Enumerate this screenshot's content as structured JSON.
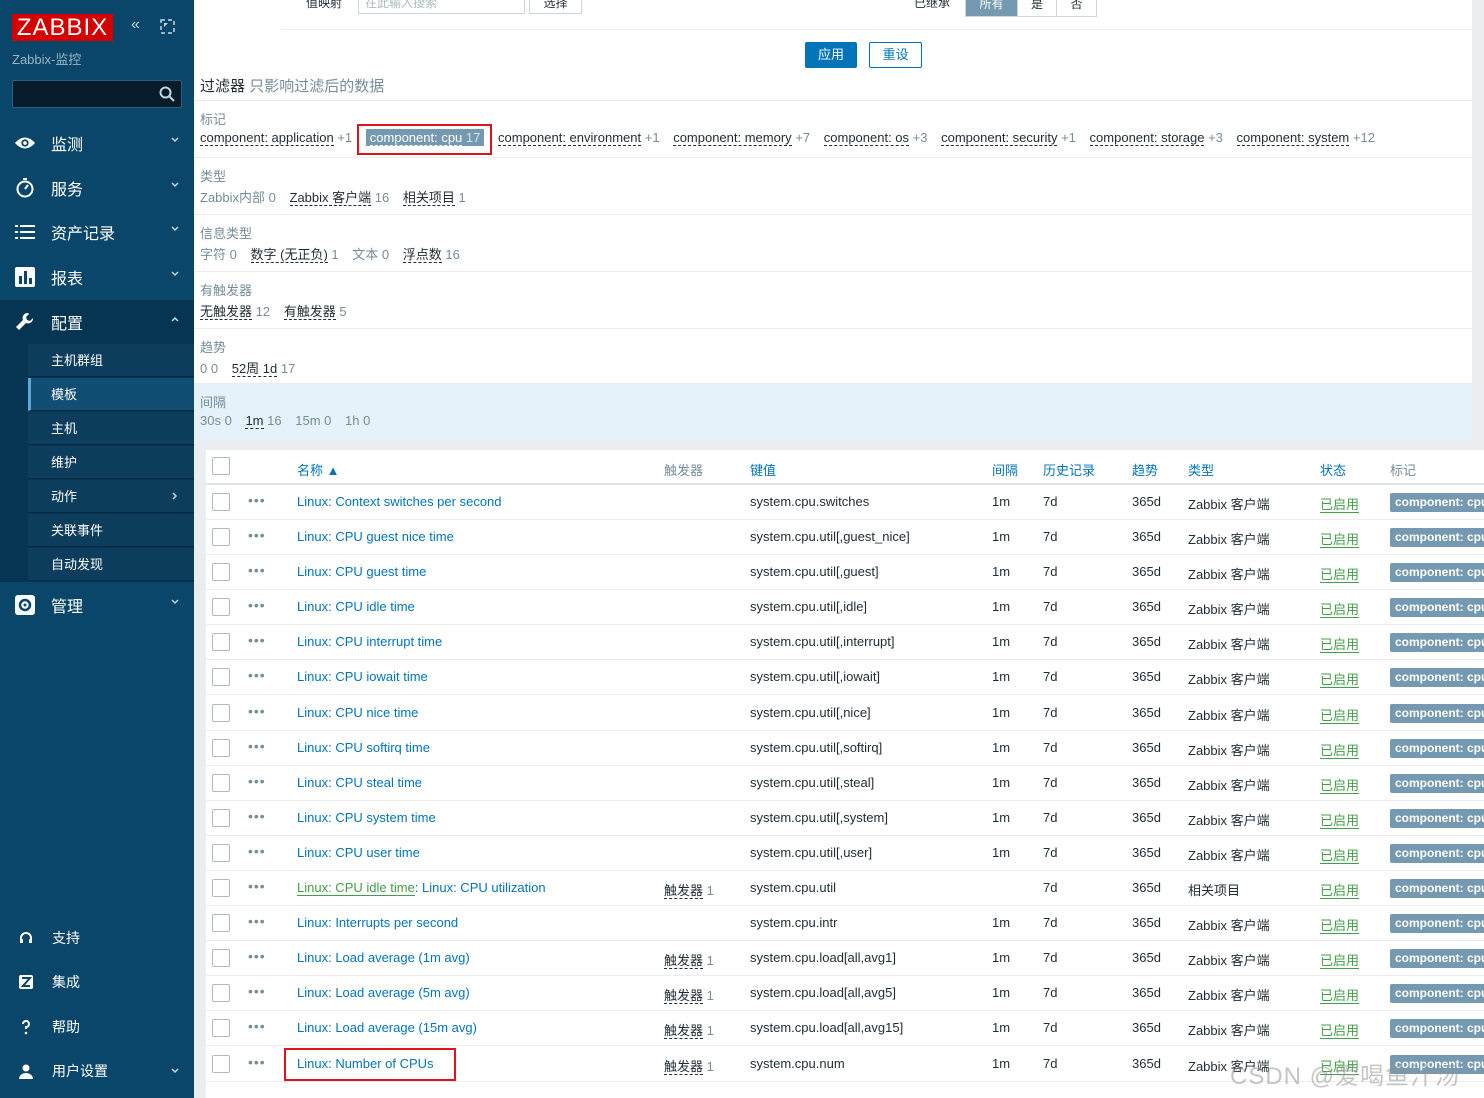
{
  "sidebar": {
    "logo": "ZABBIX",
    "collapse_glyph": "«",
    "server_name": "Zabbix-监控",
    "search_placeholder": "",
    "menu": [
      {
        "label": "监测",
        "icon": "eye-icon"
      },
      {
        "label": "服务",
        "icon": "clock-icon"
      },
      {
        "label": "资产记录",
        "icon": "list-icon"
      },
      {
        "label": "报表",
        "icon": "bar-chart-icon"
      },
      {
        "label": "配置",
        "icon": "wrench-icon"
      },
      {
        "label": "管理",
        "icon": "gear-icon"
      }
    ],
    "config_sub": [
      {
        "label": "主机群组"
      },
      {
        "label": "模板"
      },
      {
        "label": "主机"
      },
      {
        "label": "维护"
      },
      {
        "label": "动作"
      },
      {
        "label": "关联事件"
      },
      {
        "label": "自动发现"
      }
    ],
    "bottom": [
      {
        "label": "支持",
        "icon": "headset-icon"
      },
      {
        "label": "集成",
        "icon": "integration-icon"
      },
      {
        "label": "帮助",
        "icon": "help-icon"
      },
      {
        "label": "用户设置",
        "icon": "user-icon"
      }
    ]
  },
  "filter": {
    "cut_label_left": "值映射",
    "cut_input_placeholder": "在此输入搜索",
    "cut_select_btn": "选择",
    "cut_label_right": "已继承",
    "inherited_options": [
      "所有",
      "是",
      "否"
    ],
    "apply_label": "应用",
    "reset_label": "重设",
    "title": "过滤器",
    "title_hint": "只影响过滤后的数据",
    "groups": {
      "tags": {
        "label": "标记",
        "items": [
          {
            "name": "component: application",
            "count": "+1"
          },
          {
            "name": "component: cpu",
            "count": "17"
          },
          {
            "name": "component: environment",
            "count": "+1"
          },
          {
            "name": "component: memory",
            "count": "+7"
          },
          {
            "name": "component: os",
            "count": "+3"
          },
          {
            "name": "component: security",
            "count": "+1"
          },
          {
            "name": "component: storage",
            "count": "+3"
          },
          {
            "name": "component: system",
            "count": "+12"
          }
        ]
      },
      "type": {
        "label": "类型",
        "items": [
          {
            "name": "Zabbix内部",
            "count": "0"
          },
          {
            "name": "Zabbix 客户端",
            "count": "16"
          },
          {
            "name": "相关项目",
            "count": "1"
          }
        ]
      },
      "info_type": {
        "label": "信息类型",
        "items": [
          {
            "name": "字符",
            "count": "0"
          },
          {
            "name": "数字 (无正负)",
            "count": "1"
          },
          {
            "name": "文本",
            "count": "0"
          },
          {
            "name": "浮点数",
            "count": "16"
          }
        ]
      },
      "triggers": {
        "label": "有触发器",
        "items": [
          {
            "name": "无触发器",
            "count": "12"
          },
          {
            "name": "有触发器",
            "count": "5"
          }
        ]
      },
      "trends": {
        "label": "趋势",
        "items": [
          {
            "name": "0",
            "count": "0"
          },
          {
            "name": "52周 1d",
            "count": "17"
          }
        ]
      },
      "interval": {
        "label": "间隔",
        "items": [
          {
            "name": "30s",
            "count": "0"
          },
          {
            "name": "1m",
            "count": "16"
          },
          {
            "name": "15m",
            "count": "0"
          },
          {
            "name": "1h",
            "count": "0"
          }
        ]
      }
    }
  },
  "table": {
    "headers": {
      "name": "名称 ▲",
      "triggers": "触发器",
      "key": "键值",
      "interval": "间隔",
      "history": "历史记录",
      "trends": "趋势",
      "type": "类型",
      "status": "状态",
      "tags": "标记"
    },
    "rows": [
      {
        "prefix": "Linux: ",
        "name": "Context switches per second",
        "trig": "",
        "trig_count": "",
        "key": "system.cpu.switches",
        "interval": "1m",
        "history": "7d",
        "trends": "365d",
        "type": "Zabbix 客户端",
        "status": "已启用",
        "tag": "component: cpu"
      },
      {
        "prefix": "Linux: ",
        "name": "CPU guest nice time",
        "trig": "",
        "trig_count": "",
        "key": "system.cpu.util[,guest_nice]",
        "interval": "1m",
        "history": "7d",
        "trends": "365d",
        "type": "Zabbix 客户端",
        "status": "已启用",
        "tag": "component: cpu"
      },
      {
        "prefix": "Linux: ",
        "name": "CPU guest time",
        "trig": "",
        "trig_count": "",
        "key": "system.cpu.util[,guest]",
        "interval": "1m",
        "history": "7d",
        "trends": "365d",
        "type": "Zabbix 客户端",
        "status": "已启用",
        "tag": "component: cpu"
      },
      {
        "prefix": "Linux: ",
        "name": "CPU idle time",
        "trig": "",
        "trig_count": "",
        "key": "system.cpu.util[,idle]",
        "interval": "1m",
        "history": "7d",
        "trends": "365d",
        "type": "Zabbix 客户端",
        "status": "已启用",
        "tag": "component: cpu"
      },
      {
        "prefix": "Linux: ",
        "name": "CPU interrupt time",
        "trig": "",
        "trig_count": "",
        "key": "system.cpu.util[,interrupt]",
        "interval": "1m",
        "history": "7d",
        "trends": "365d",
        "type": "Zabbix 客户端",
        "status": "已启用",
        "tag": "component: cpu"
      },
      {
        "prefix": "Linux: ",
        "name": "CPU iowait time",
        "trig": "",
        "trig_count": "",
        "key": "system.cpu.util[,iowait]",
        "interval": "1m",
        "history": "7d",
        "trends": "365d",
        "type": "Zabbix 客户端",
        "status": "已启用",
        "tag": "component: cpu"
      },
      {
        "prefix": "Linux: ",
        "name": "CPU nice time",
        "trig": "",
        "trig_count": "",
        "key": "system.cpu.util[,nice]",
        "interval": "1m",
        "history": "7d",
        "trends": "365d",
        "type": "Zabbix 客户端",
        "status": "已启用",
        "tag": "component: cpu"
      },
      {
        "prefix": "Linux: ",
        "name": "CPU softirq time",
        "trig": "",
        "trig_count": "",
        "key": "system.cpu.util[,softirq]",
        "interval": "1m",
        "history": "7d",
        "trends": "365d",
        "type": "Zabbix 客户端",
        "status": "已启用",
        "tag": "component: cpu"
      },
      {
        "prefix": "Linux: ",
        "name": "CPU steal time",
        "trig": "",
        "trig_count": "",
        "key": "system.cpu.util[,steal]",
        "interval": "1m",
        "history": "7d",
        "trends": "365d",
        "type": "Zabbix 客户端",
        "status": "已启用",
        "tag": "component: cpu"
      },
      {
        "prefix": "Linux: ",
        "name": "CPU system time",
        "trig": "",
        "trig_count": "",
        "key": "system.cpu.util[,system]",
        "interval": "1m",
        "history": "7d",
        "trends": "365d",
        "type": "Zabbix 客户端",
        "status": "已启用",
        "tag": "component: cpu"
      },
      {
        "prefix": "Linux: ",
        "name": "CPU user time",
        "trig": "",
        "trig_count": "",
        "key": "system.cpu.util[,user]",
        "interval": "1m",
        "history": "7d",
        "trends": "365d",
        "type": "Zabbix 客户端",
        "status": "已启用",
        "tag": "component: cpu"
      },
      {
        "prefix": "Linux: CPU idle time",
        "name": ": Linux: CPU utilization",
        "prefix_green": true,
        "trig": "触发器",
        "trig_count": "1",
        "key": "system.cpu.util",
        "interval": "",
        "history": "7d",
        "trends": "365d",
        "type": "相关项目",
        "status": "已启用",
        "tag": "component: cpu"
      },
      {
        "prefix": "Linux: ",
        "name": "Interrupts per second",
        "trig": "",
        "trig_count": "",
        "key": "system.cpu.intr",
        "interval": "1m",
        "history": "7d",
        "trends": "365d",
        "type": "Zabbix 客户端",
        "status": "已启用",
        "tag": "component: cpu"
      },
      {
        "prefix": "Linux: ",
        "name": "Load average (1m avg)",
        "trig": "触发器",
        "trig_count": "1",
        "key": "system.cpu.load[all,avg1]",
        "interval": "1m",
        "history": "7d",
        "trends": "365d",
        "type": "Zabbix 客户端",
        "status": "已启用",
        "tag": "component: cpu"
      },
      {
        "prefix": "Linux: ",
        "name": "Load average (5m avg)",
        "trig": "触发器",
        "trig_count": "1",
        "key": "system.cpu.load[all,avg5]",
        "interval": "1m",
        "history": "7d",
        "trends": "365d",
        "type": "Zabbix 客户端",
        "status": "已启用",
        "tag": "component: cpu"
      },
      {
        "prefix": "Linux: ",
        "name": "Load average (15m avg)",
        "trig": "触发器",
        "trig_count": "1",
        "key": "system.cpu.load[all,avg15]",
        "interval": "1m",
        "history": "7d",
        "trends": "365d",
        "type": "Zabbix 客户端",
        "status": "已启用",
        "tag": "component: cpu"
      },
      {
        "prefix": "Linux: ",
        "name": "Number of CPUs",
        "trig": "触发器",
        "trig_count": "1",
        "key": "system.cpu.num",
        "interval": "1m",
        "history": "7d",
        "trends": "365d",
        "type": "Zabbix 客户端",
        "status": "已启用",
        "tag": "component: cpu"
      }
    ]
  },
  "watermark": "CSDN @爱喝鱼汁汤",
  "colors": {
    "sidebar_bg": "#0a466a",
    "logo_red": "#d40000",
    "link_blue": "#0275b8",
    "enabled_green": "#429e47",
    "tag_bg": "#7499b0",
    "highlight_red": "#e0141e"
  }
}
